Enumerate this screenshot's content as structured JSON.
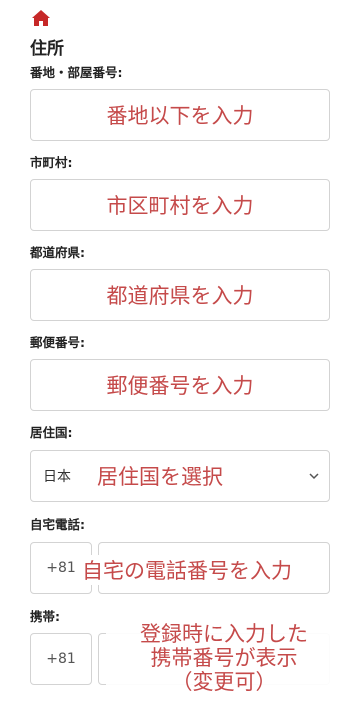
{
  "header": {
    "home_icon": "home-icon",
    "section_title": "住所"
  },
  "fields": {
    "street": {
      "label": "番地・部屋番号:",
      "placeholder": "番地以下を入力"
    },
    "city": {
      "label": "市町村:",
      "placeholder": "市区町村を入力"
    },
    "prefecture": {
      "label": "都道府県:",
      "placeholder": "都道府県を入力"
    },
    "postal": {
      "label": "郵便番号:",
      "placeholder": "郵便番号を入力"
    },
    "country": {
      "label": "居住国:",
      "value": "日本",
      "placeholder": "居住国を選択"
    },
    "home_phone": {
      "label": "自宅電話:",
      "country_code": "+81",
      "placeholder": "自宅の電話番号を入力"
    },
    "mobile": {
      "label": "携帯:",
      "country_code": "+81",
      "note_lines": [
        "登録時に入力した",
        "携帯番号が表示",
        "（変更可）"
      ]
    }
  },
  "colors": {
    "accent": "#c54a4a",
    "home_icon": "#c62828",
    "border": "#d3d3d3"
  }
}
